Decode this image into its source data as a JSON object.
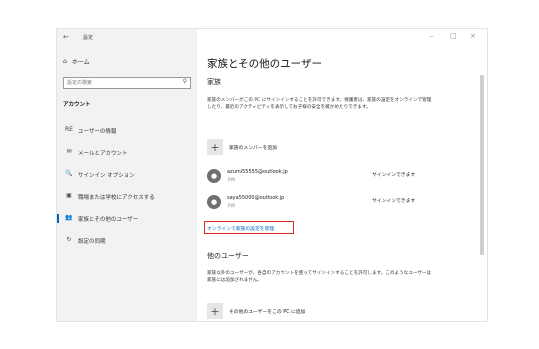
{
  "titlebar": {
    "back": "←",
    "title": "設定",
    "minimize": "–",
    "maximize": "□",
    "close": "×"
  },
  "sidebar": {
    "home_label": "ホーム",
    "search_placeholder": "設定の検索",
    "section_label": "アカウント",
    "items": [
      {
        "icon": "RE",
        "label": "ユーザーの情報"
      },
      {
        "icon": "✉",
        "label": "メールとアカウント"
      },
      {
        "icon": "🔍",
        "label": "サインイン オプション"
      },
      {
        "icon": "▣",
        "label": "職場または学校にアクセスする"
      },
      {
        "icon": "👥",
        "label": "家族とその他のユーザー"
      },
      {
        "icon": "↻",
        "label": "設定の同期"
      }
    ]
  },
  "main": {
    "title": "家族とその他のユーザー",
    "family_heading": "家族",
    "family_desc": "家族のメンバーがこの PC にサインインすることを許可できます。保護者は、家族の設定をオンラインで管理したり、最近のアクティビティを表示してお子様の安全を確かめたりできます。",
    "add_family_label": "家族のメンバーを追加",
    "accounts": [
      {
        "email": "azumi55555@outlook.jp",
        "role": "子供",
        "status": "サインインできます"
      },
      {
        "email": "saya55000@outlook.jp",
        "role": "子供",
        "status": "サインインできます"
      }
    ],
    "manage_link": "オンラインで家族の設定を管理",
    "other_heading": "他のユーザー",
    "other_desc": "家族以外のユーザーが、各自のアカウントを使ってサインインすることを許可します。このようなユーザーは家族には追加されません。",
    "add_other_label": "その他のユーザーをこの PC に追加"
  }
}
